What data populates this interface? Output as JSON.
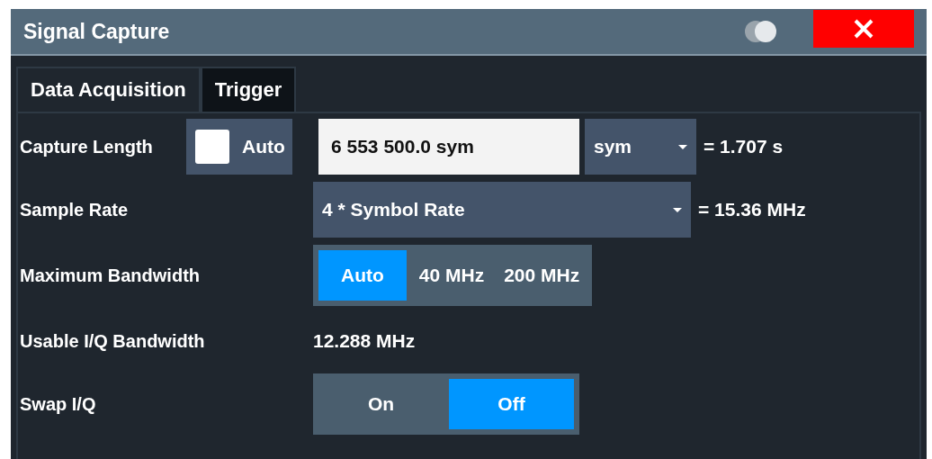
{
  "window": {
    "title": "Signal Capture"
  },
  "tabs": [
    {
      "label": "Data Acquisition",
      "selected": true
    },
    {
      "label": "Trigger",
      "selected": false
    }
  ],
  "settings": [
    {
      "kind": "length",
      "label": "Capture Length",
      "auto": {
        "label": "Auto",
        "checked": false
      },
      "value": "6 553 500.0 sym",
      "unit": "sym",
      "result": "= 1.707 s"
    },
    {
      "kind": "dropdown",
      "label": "Sample Rate",
      "value": "4 * Symbol Rate",
      "result": "= 15.36 MHz"
    },
    {
      "kind": "segmented",
      "label": "Maximum Bandwidth",
      "options": [
        {
          "label": "Auto",
          "selected": true
        },
        {
          "label": "40 MHz",
          "selected": false
        },
        {
          "label": "200 MHz",
          "selected": false
        }
      ]
    },
    {
      "kind": "readout",
      "label": "Usable I/Q Bandwidth",
      "value": "12.288 MHz"
    },
    {
      "kind": "toggle",
      "label": "Swap I/Q",
      "options": [
        {
          "label": "On",
          "selected": false
        },
        {
          "label": "Off",
          "selected": true
        }
      ]
    }
  ]
}
